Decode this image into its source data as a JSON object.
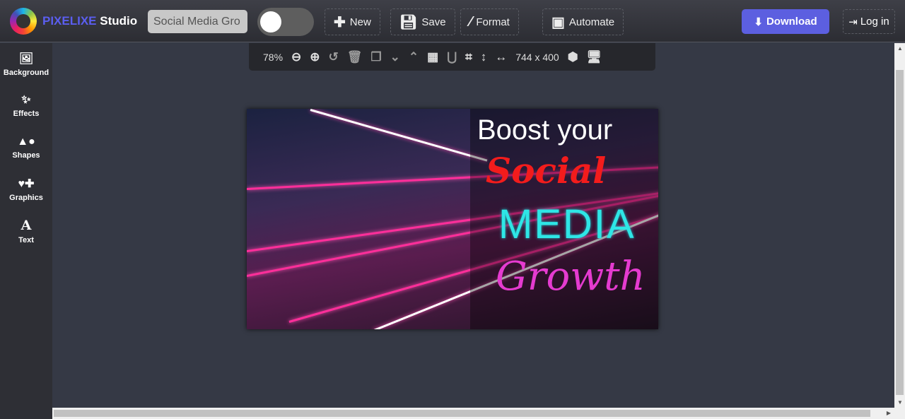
{
  "header": {
    "brand_prefix": "PIXELIXE",
    "brand_suffix": "Studio",
    "title_value": "Social Media Gro",
    "new": "New",
    "save": "Save",
    "format": "Format",
    "automate": "Automate",
    "download": "Download",
    "login": "Log in"
  },
  "sidebar": {
    "items": [
      {
        "label": "Background",
        "icon": "image-icon"
      },
      {
        "label": "Effects",
        "icon": "magic-wand-icon"
      },
      {
        "label": "Shapes",
        "icon": "shapes-icon"
      },
      {
        "label": "Graphics",
        "icon": "graphics-icon"
      },
      {
        "label": "Text",
        "icon": "text-icon"
      }
    ]
  },
  "canvas_toolbar": {
    "zoom": "78%",
    "size": "744 x 400"
  },
  "artwork": {
    "line1": "Boost your",
    "line2": "Social",
    "line3": "MEDIA",
    "line4": "Growth"
  },
  "colors": {
    "accent": "#5c5fe0",
    "brand": "#5b5ef0"
  }
}
